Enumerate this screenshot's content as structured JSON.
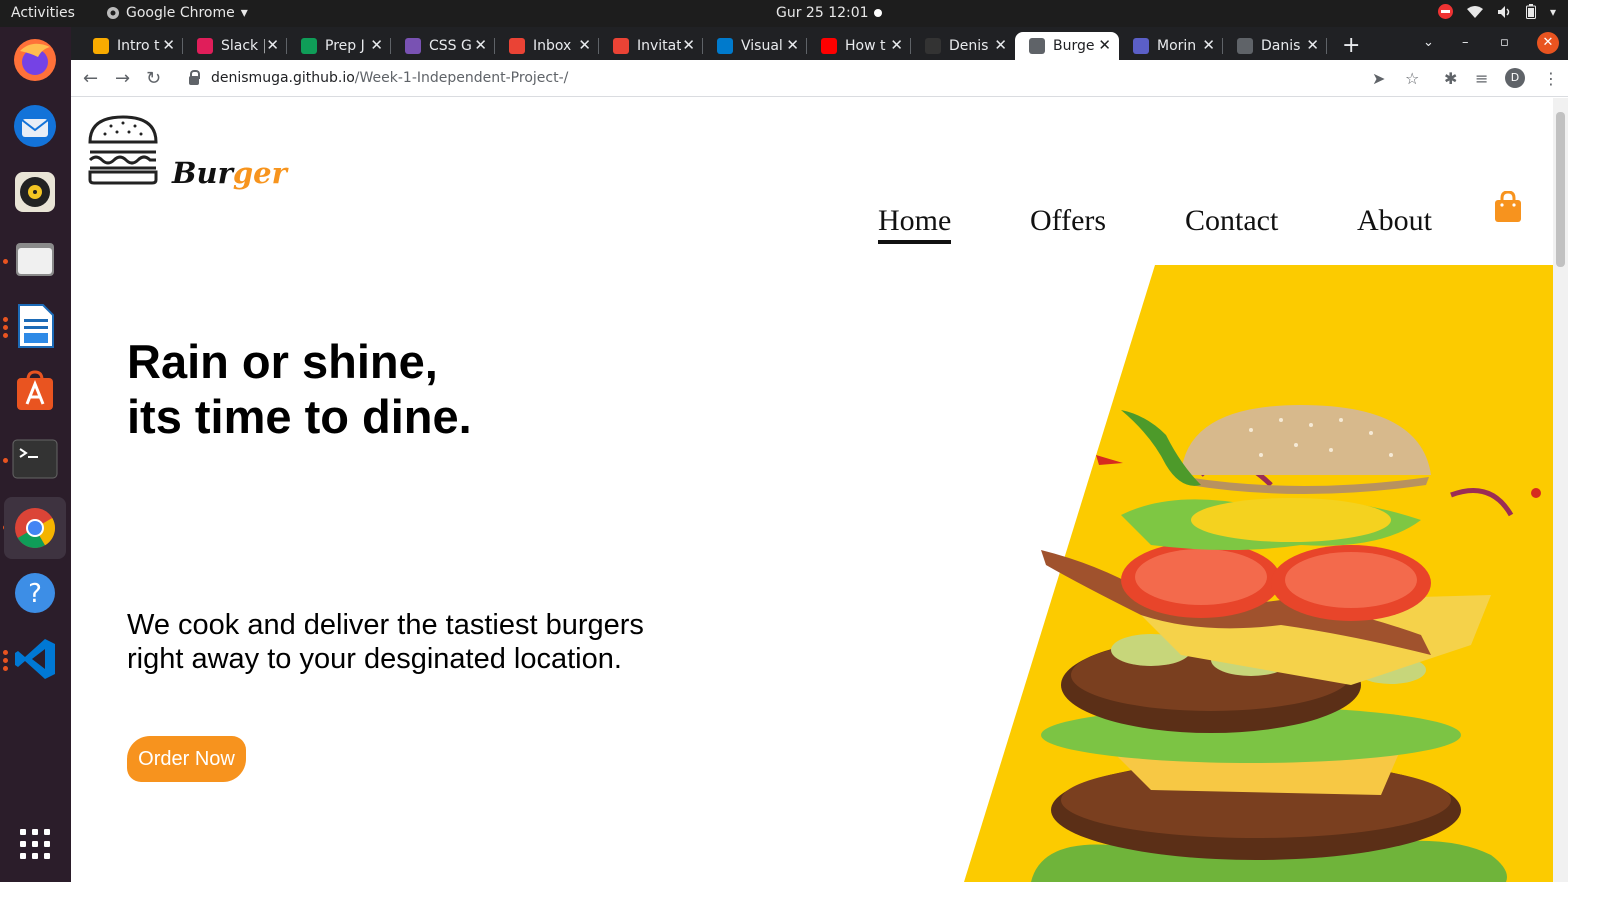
{
  "os_bar": {
    "activities": "Activities",
    "app_name": "Google Chrome",
    "clock": "Gur 25  12:01"
  },
  "dock": {
    "items": [
      "firefox-icon",
      "thunderbird-icon",
      "rhythmbox-icon",
      "files-icon",
      "writer-icon",
      "software-icon",
      "terminal-icon",
      "chrome-icon",
      "help-icon",
      "vscode-icon"
    ],
    "show_apps": "apps-grid-icon"
  },
  "browser": {
    "tabs": [
      {
        "title": "Intro t",
        "color": "#f9ab00"
      },
      {
        "title": "Slack |",
        "color": "#e01e5a"
      },
      {
        "title": "Prep J",
        "color": "#0f9d58"
      },
      {
        "title": "CSS Gr",
        "color": "#7952b3"
      },
      {
        "title": "Inbox",
        "color": "#ea4335"
      },
      {
        "title": "Invitat",
        "color": "#ea4335"
      },
      {
        "title": "Visual",
        "color": "#007acc"
      },
      {
        "title": "How t",
        "color": "#ff0000"
      },
      {
        "title": "Denis",
        "color": "#333333"
      },
      {
        "title": "Burge",
        "color": "#5f6368"
      },
      {
        "title": "Morin",
        "color": "#5b5fc7"
      },
      {
        "title": "Danis",
        "color": "#5f6368"
      }
    ],
    "active_tab": 9,
    "url_host": "denismuga.github.io",
    "url_path": "/Week-1-Independent-Project-/",
    "profile_initial": "D"
  },
  "site": {
    "logo": {
      "part1": "Bur",
      "part2": "ger"
    },
    "nav": [
      "Home",
      "Offers",
      "Contact",
      "About"
    ],
    "headline_line1": "Rain or shine,",
    "headline_line2": "its time to dine.",
    "sub_line1": "We cook and deliver the tastiest burgers",
    "sub_line2": "right away to your desginated location.",
    "order_button": "Order Now",
    "colors": {
      "accent": "#f7931e",
      "hero_bg": "#fccb00"
    }
  }
}
